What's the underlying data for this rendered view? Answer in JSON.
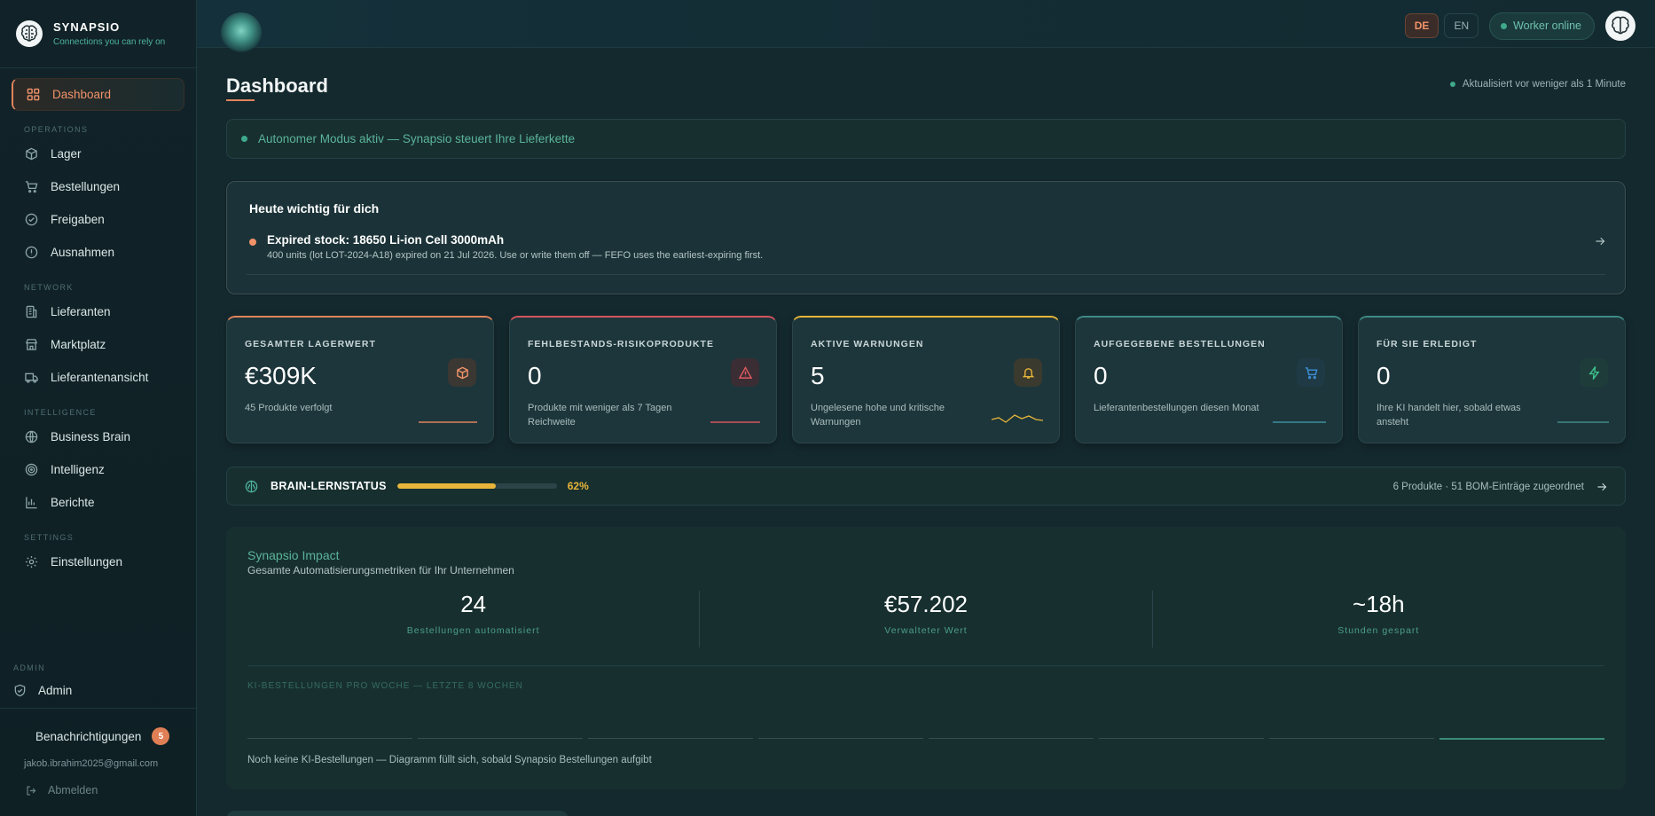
{
  "brand": {
    "name": "SYNAPSIO",
    "tagline": "Connections you can rely on"
  },
  "sidebar": {
    "active": {
      "label": "Dashboard",
      "icon": "dashboard-grid-icon"
    },
    "sections": [
      {
        "title": "OPERATIONS",
        "items": [
          {
            "label": "Lager",
            "icon": "box-icon"
          },
          {
            "label": "Bestellungen",
            "icon": "cart-icon"
          },
          {
            "label": "Freigaben",
            "icon": "check-circle-icon"
          },
          {
            "label": "Ausnahmen",
            "icon": "alert-circle-icon"
          }
        ]
      },
      {
        "title": "NETWORK",
        "items": [
          {
            "label": "Lieferanten",
            "icon": "building-icon"
          },
          {
            "label": "Marktplatz",
            "icon": "store-icon"
          },
          {
            "label": "Lieferantenansicht",
            "icon": "truck-icon"
          }
        ]
      },
      {
        "title": "INTELLIGENCE",
        "items": [
          {
            "label": "Business Brain",
            "icon": "globe-icon"
          },
          {
            "label": "Intelligenz",
            "icon": "radar-icon"
          },
          {
            "label": "Berichte",
            "icon": "bar-chart-icon"
          }
        ]
      },
      {
        "title": "SETTINGS",
        "items": [
          {
            "label": "Einstellungen",
            "icon": "gear-icon"
          }
        ]
      }
    ],
    "admin_section": "ADMIN",
    "admin_label": "Admin",
    "notifications_label": "Benachrichtigungen",
    "notifications_count": "5",
    "user_email": "jakob.ibrahim2025@gmail.com",
    "logout_label": "Abmelden"
  },
  "topbar": {
    "lang_de": "DE",
    "lang_en": "EN",
    "active_lang": "DE",
    "worker_status": "Worker online"
  },
  "page": {
    "title": "Dashboard",
    "updated": "Aktualisiert vor weniger als 1 Minute",
    "autonomous_banner": "Autonomer Modus aktiv — Synapsio steuert Ihre Lieferkette"
  },
  "today": {
    "title": "Heute wichtig für dich",
    "item_title": "Expired stock: 18650 Li-ion Cell 3000mAh",
    "item_desc": "400 units (lot LOT-2024-A18) expired on 21 Jul 2026. Use or write them off — FEFO uses the earliest-expiring first."
  },
  "kpis": [
    {
      "label": "GESAMTER LAGERWERT",
      "value": "€309K",
      "sub": "45 Produkte verfolgt",
      "accent": "#e0845c",
      "icon": "box-icon",
      "icon_color": "#f0936a",
      "icon_bg": "#3b3733"
    },
    {
      "label": "FEHLBESTANDS-RISIKOPRODUKTE",
      "value": "0",
      "sub": "Produkte mit weniger als 7 Tagen Reichweite",
      "accent": "#d6545e",
      "icon": "warning-triangle-icon",
      "icon_color": "#e05a63",
      "icon_bg": "#3a2d33"
    },
    {
      "label": "AKTIVE WARNUNGEN",
      "value": "5",
      "sub": "Ungelesene hohe und kritische Warnungen",
      "accent": "#e8b53a",
      "icon": "bell-icon",
      "icon_color": "#e8b53a",
      "icon_bg": "#3a3a2e"
    },
    {
      "label": "AUFGEGEBENE BESTELLUNGEN",
      "value": "0",
      "sub": "Lieferantenbestellungen diesen Monat",
      "accent": "#3e8a86",
      "icon": "cart-icon",
      "icon_color": "#3b8fd6",
      "icon_bg": "#1f3a45"
    },
    {
      "label": "FÜR SIE ERLEDIGT",
      "value": "0",
      "sub": "Ihre KI handelt hier, sobald etwas ansteht",
      "accent": "#3e8a86",
      "icon": "lightning-icon",
      "icon_color": "#3fc28f",
      "icon_bg": "#1e3d3a"
    }
  ],
  "brain": {
    "label": "BRAIN-LERNSTATUS",
    "progress": 62,
    "progress_text": "62%",
    "summary": "6 Produkte · 51 BOM-Einträge zugeordnet"
  },
  "impact": {
    "title": "Synapsio Impact",
    "subtitle": "Gesamte Automatisierungsmetriken für Ihr Unternehmen",
    "metrics": [
      {
        "value": "24",
        "label": "Bestellungen automatisiert"
      },
      {
        "value": "€57.202",
        "label": "Verwalteter Wert"
      },
      {
        "value": "~18h",
        "label": "Stunden gespart"
      }
    ],
    "chart_title": "KI-BESTELLUNGEN PRO WOCHE — LETZTE 8 WOCHEN",
    "empty_text": "Noch keine KI-Bestellungen — Diagramm füllt sich, sobald Synapsio Bestellungen aufgibt"
  }
}
